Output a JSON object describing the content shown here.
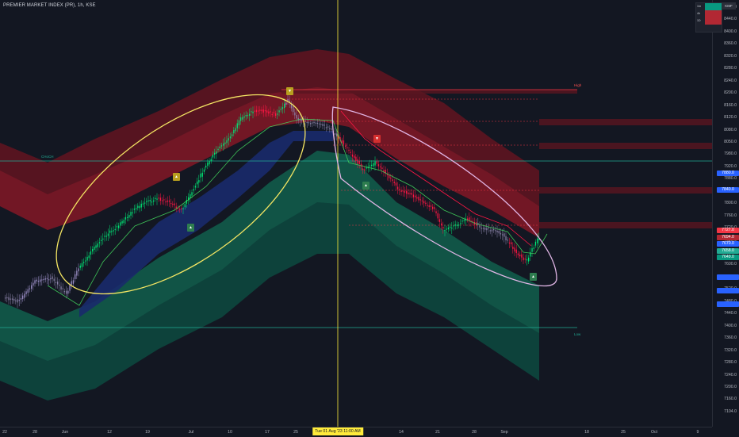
{
  "header": {
    "title": "PREMIER MARKET INDEX (PR), 1h, KSE"
  },
  "y_axis": {
    "ticks": [
      "8480.0",
      "8440.0",
      "8400.0",
      "8360.0",
      "8320.0",
      "8280.0",
      "8240.0",
      "8200.0",
      "8160.0",
      "8120.0",
      "8080.0",
      "8050.0",
      "7980.0",
      "7920.0",
      "7880.0",
      "7840.0",
      "7800.0",
      "7760.0",
      "7720.0",
      "7680.0",
      "7640.0",
      "7600.0",
      "7560.0",
      "7520.0",
      "7480.0",
      "7440.0",
      "7400.0",
      "7360.0",
      "7320.0",
      "7280.0",
      "7240.0",
      "7200.0",
      "7160.0",
      "7104.0"
    ],
    "price_labels": [
      {
        "text": "7727.0",
        "color": "#f23645"
      },
      {
        "text": "7694.0",
        "color": "#b22833"
      },
      {
        "text": "7670.0",
        "color": "#2962ff"
      },
      {
        "text": "7658.0",
        "color": "#22ab94"
      },
      {
        "text": "7649.0",
        "color": "#089981"
      }
    ],
    "side_labels": [
      "7880.0",
      "7840.0"
    ]
  },
  "x_axis": {
    "ticks": [
      "22",
      "28",
      "Jun",
      "12",
      "19",
      "Jul",
      "10",
      "17",
      "25",
      "7",
      "14",
      "21",
      "28",
      "Sep",
      "18",
      "25",
      "Oct",
      "9"
    ],
    "crosshair_label": "Tue 01 Aug '23   11:00 AM"
  },
  "legend": {
    "badge": "KMF",
    "rows": [
      {
        "k": "1hr",
        "color": "#089981"
      },
      {
        "k": "4h",
        "color": "#b22833"
      },
      {
        "k": "1D",
        "color": "#b22833"
      }
    ]
  },
  "levels": {
    "high_label": "High",
    "low_label": "Low",
    "choch_label": "CHoCH"
  },
  "markers": [
    "▼",
    "▲",
    "▼",
    "▲",
    "▲",
    "▼"
  ],
  "colors": {
    "bg": "#131722",
    "bull": "#00e676",
    "bear": "#ff1744",
    "red_band": "#6d1420",
    "green_band": "#0d4a3f",
    "blue_band": "#1a2a6c",
    "ellipse_up": "#f5e663",
    "ellipse_down": "#e1b6e6",
    "crosshair": "#ffeb3b",
    "hline": "#22ab94"
  }
}
